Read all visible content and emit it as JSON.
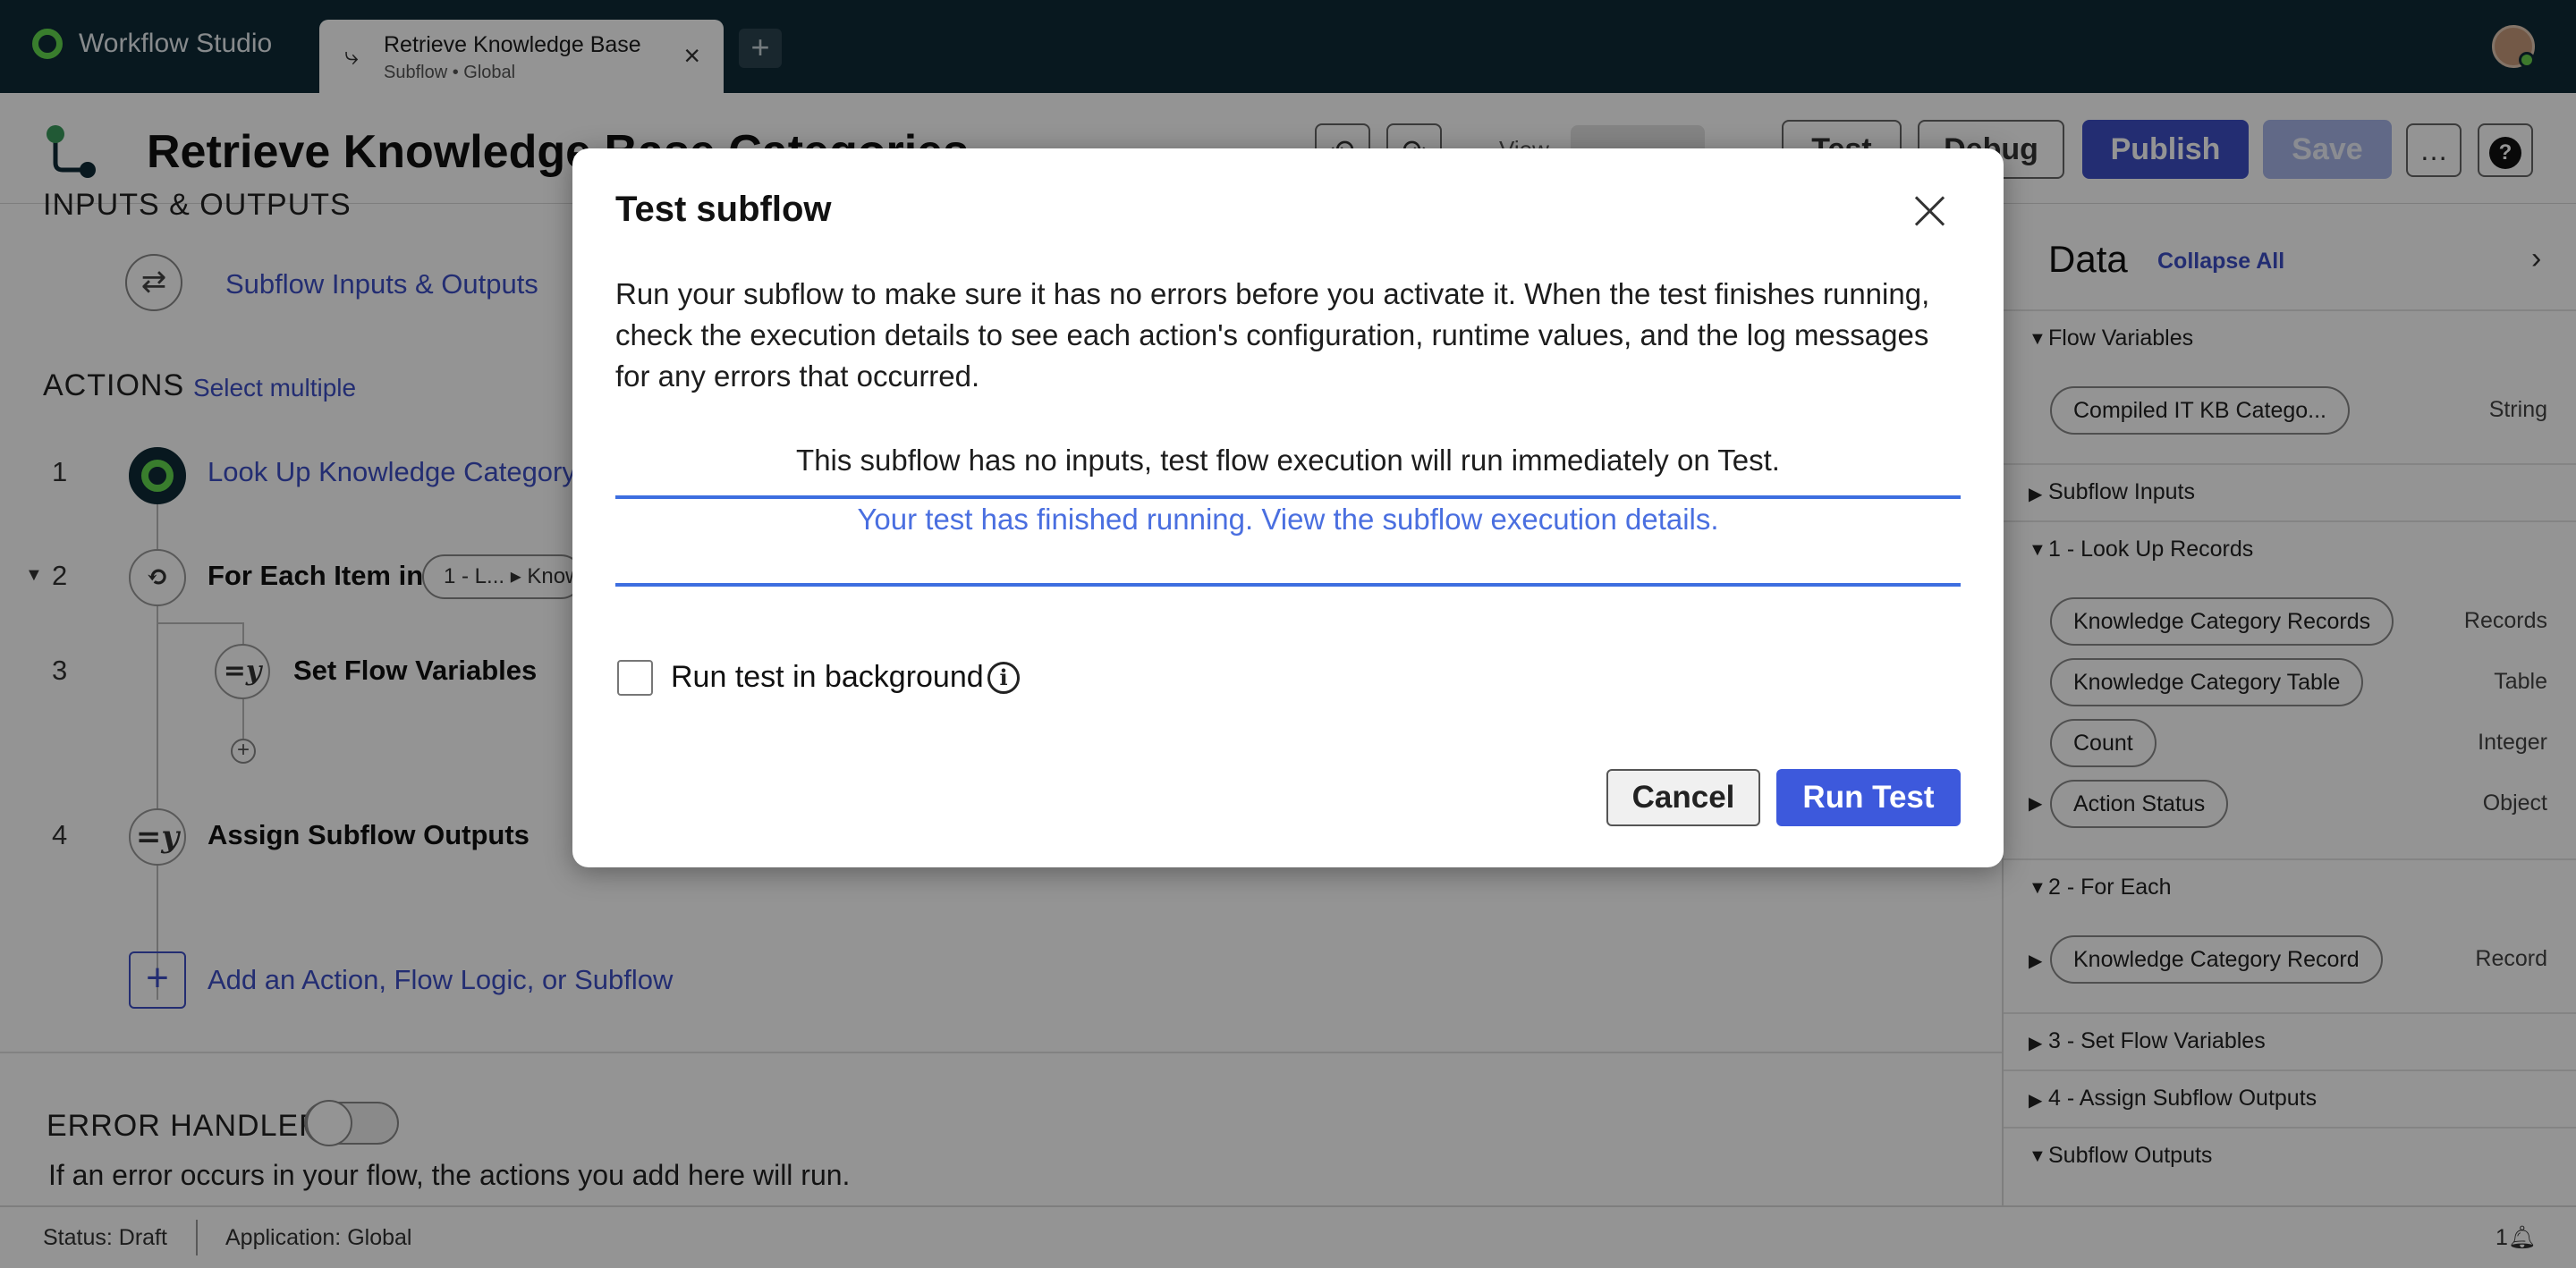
{
  "app": {
    "name": "Workflow Studio",
    "tab": {
      "title": "Retrieve Knowledge Base Categories",
      "subtitle": "Subflow • Global"
    }
  },
  "flow": {
    "title": "Retrieve Knowledge Base Categories",
    "toolbar": {
      "view_label": "View",
      "test": "Test",
      "debug": "Debug",
      "publish": "Publish",
      "save": "Save",
      "more": "…",
      "help": "?"
    }
  },
  "canvas": {
    "inputs_outputs_heading": "INPUTS & OUTPUTS",
    "inputs_outputs_link": "Subflow Inputs & Outputs",
    "actions_heading": "ACTIONS",
    "select_multiple": "Select multiple",
    "steps": [
      {
        "num": "1",
        "label": "Look Up Knowledge Category Records"
      },
      {
        "num": "2",
        "label": "For Each Item in",
        "pill": "1 - L... ▸ Knowledge Category Records"
      },
      {
        "num": "3",
        "label": "Set Flow Variables",
        "icon_text": "=y"
      },
      {
        "num": "4",
        "label": "Assign Subflow Outputs",
        "icon_text": "=y"
      }
    ],
    "add_action": "Add an Action, Flow Logic, or Subflow",
    "error_handler": {
      "title": "ERROR HANDLER",
      "description": "If an error occurs in your flow, the actions you add here will run.",
      "enabled": false
    }
  },
  "panel": {
    "title": "Data",
    "collapse_all": "Collapse All",
    "sections": {
      "flow_variables": "Flow Variables",
      "subflow_inputs": "Subflow Inputs",
      "look_up": "1 - Look Up Records",
      "for_each": "2 - For Each",
      "set_vars": "3 - Set Flow Variables",
      "assign": "4 - Assign Subflow Outputs",
      "outputs": "Subflow Outputs"
    },
    "items": {
      "compiled": {
        "label": "Compiled IT KB Catego...",
        "type": "String"
      },
      "records": {
        "label": "Knowledge Category Records",
        "type": "Records"
      },
      "table": {
        "label": "Knowledge Category Table",
        "type": "Table"
      },
      "count": {
        "label": "Count",
        "type": "Integer"
      },
      "action_status": {
        "label": "Action Status",
        "type": "Object"
      },
      "record": {
        "label": "Knowledge Category Record",
        "type": "Record"
      }
    }
  },
  "status": {
    "status": "Status: Draft",
    "application": "Application: Global",
    "notifications": "1"
  },
  "modal": {
    "title": "Test subflow",
    "description": "Run your subflow to make sure it has no errors before you activate it. When the test finishes running, check the execution details to see each action's configuration, runtime values, and the log messages for any errors that occurred.",
    "no_inputs_note": "This subflow has no inputs, test flow execution will run immediately on Test.",
    "finished_link": "Your test has finished running. View the subflow execution details.",
    "background_label": "Run test in background",
    "background_checked": false,
    "cancel": "Cancel",
    "run_test": "Run Test"
  },
  "colors": {
    "accent": "#3d4fc4",
    "topbar": "#0e2a36",
    "brand_green": "#62d84e"
  },
  "icons": [
    "workflow-logo-icon",
    "subflow-tab-icon",
    "close-icon",
    "plus-icon",
    "undo-icon",
    "redo-icon",
    "more-icon",
    "help-icon",
    "swap-arrows-icon",
    "info-icon",
    "bell-icon",
    "chevron-right-icon"
  ]
}
